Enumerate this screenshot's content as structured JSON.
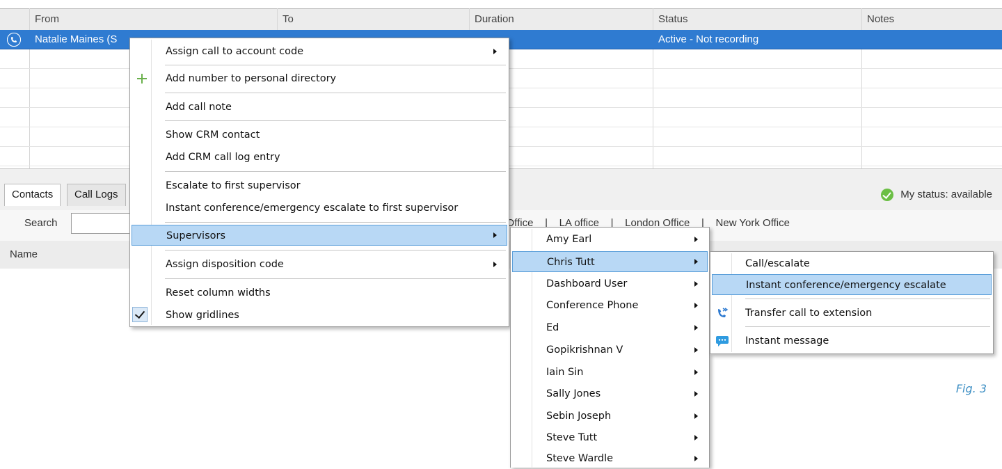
{
  "grid": {
    "columns": [
      "From",
      "To",
      "Duration",
      "Status",
      "Notes"
    ],
    "selected_row": {
      "from": "Natalie Maines (S",
      "to": "",
      "duration": "",
      "status": "Active - Not recording",
      "notes": ""
    }
  },
  "lower_panel": {
    "tabs": [
      "Contacts",
      "Call Logs"
    ],
    "my_status": "My status: available",
    "search_label": "Search",
    "office_links": "a Office    |    LA office    |    London Office    |    New York Office",
    "name_column": "Name"
  },
  "context_menu": {
    "items": [
      {
        "label": "Assign call to account code",
        "submenu": true
      },
      {
        "label": "Add number to personal directory",
        "icon": "plus-icon"
      },
      {
        "label": "Add call note"
      },
      {
        "label": "Show CRM contact"
      },
      {
        "label": "Add CRM call log entry"
      },
      {
        "label": "Escalate to first supervisor"
      },
      {
        "label": "Instant conference/emergency escalate to first supervisor"
      },
      {
        "label": "Supervisors",
        "submenu": true,
        "highlighted": true
      },
      {
        "label": "Assign disposition code",
        "submenu": true
      },
      {
        "label": "Reset column widths"
      },
      {
        "label": "Show gridlines",
        "checked": true
      }
    ]
  },
  "supervisors_menu": {
    "items": [
      "Amy Earl",
      "Chris Tutt",
      "Dashboard User",
      "Conference Phone",
      "Ed",
      "Gopikrishnan V",
      "Iain Sin",
      "Sally Jones",
      "Sebin Joseph",
      "Steve Tutt",
      "Steve Wardle"
    ],
    "highlighted": "Chris Tutt"
  },
  "supervisor_actions_menu": {
    "items": [
      {
        "label": "Call/escalate"
      },
      {
        "label": "Instant conference/emergency escalate",
        "highlighted": true
      },
      {
        "label": "Transfer call to extension",
        "icon": "transfer-call-icon"
      },
      {
        "label": "Instant message",
        "icon": "chat-bubble-icon"
      }
    ]
  },
  "figure_caption": "Fig. 3",
  "colors": {
    "selection_blue": "#2f7bd1",
    "menu_highlight": "#b8d8f5",
    "status_green": "#6bbf45",
    "caption_blue": "#3d8fc4"
  }
}
